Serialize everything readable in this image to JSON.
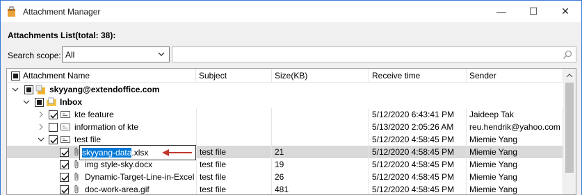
{
  "window": {
    "title": "Attachment Manager",
    "minimize_glyph": "—",
    "maximize_glyph": "☐",
    "close_glyph": "✕"
  },
  "attachments_heading": "Attachments List(total: 38):",
  "search": {
    "scope_label": "Search scope:",
    "scope_value": "All",
    "placeholder": ""
  },
  "columns": {
    "name": "Attachment Name",
    "subject": "Subject",
    "size": "Size(KB)",
    "receive": "Receive time",
    "sender": "Sender"
  },
  "tree": {
    "account": "skyyang@extendoffice.com",
    "folder": "Inbox",
    "items": [
      {
        "name": "kte feature",
        "subject": "",
        "size": "",
        "receive": "5/12/2020 6:43:41 PM",
        "sender": "Jaideep Tak"
      },
      {
        "name": "information of kte",
        "subject": "",
        "size": "",
        "receive": "5/13/2020 2:05:26 AM",
        "sender": "reu.hendrik@yahoo.com"
      },
      {
        "name": "test file",
        "subject": "",
        "size": "",
        "receive": "5/12/2020 4:58:45 PM",
        "sender": "Miemie Yang"
      }
    ],
    "attachments": [
      {
        "name": "skyyang-data.xlsx",
        "subject": "test file",
        "size": "21",
        "receive": "5/12/2020 4:58:45 PM",
        "sender": "Miemie Yang"
      },
      {
        "name": "img style-sky.docx",
        "subject": "test file",
        "size": "19",
        "receive": "5/12/2020 4:58:45 PM",
        "sender": "Miemie Yang"
      },
      {
        "name": "Dynamic-Target-Line-in-Excel",
        "subject": "test file",
        "size": "26",
        "receive": "5/12/2020 4:58:45 PM",
        "sender": "Miemie Yang"
      },
      {
        "name": "doc-work-area.gif",
        "subject": "test file",
        "size": "481",
        "receive": "5/12/2020 4:58:45 PM",
        "sender": "Miemie Yang"
      }
    ]
  },
  "rename_edit": {
    "selected": "skyyang-data",
    "rest": ".xlsx"
  },
  "colors": {
    "accent": "#0078d7",
    "selected_row": "#d9d9d9",
    "window_border": "#3a7bd5",
    "arrow": "#c0392b"
  }
}
